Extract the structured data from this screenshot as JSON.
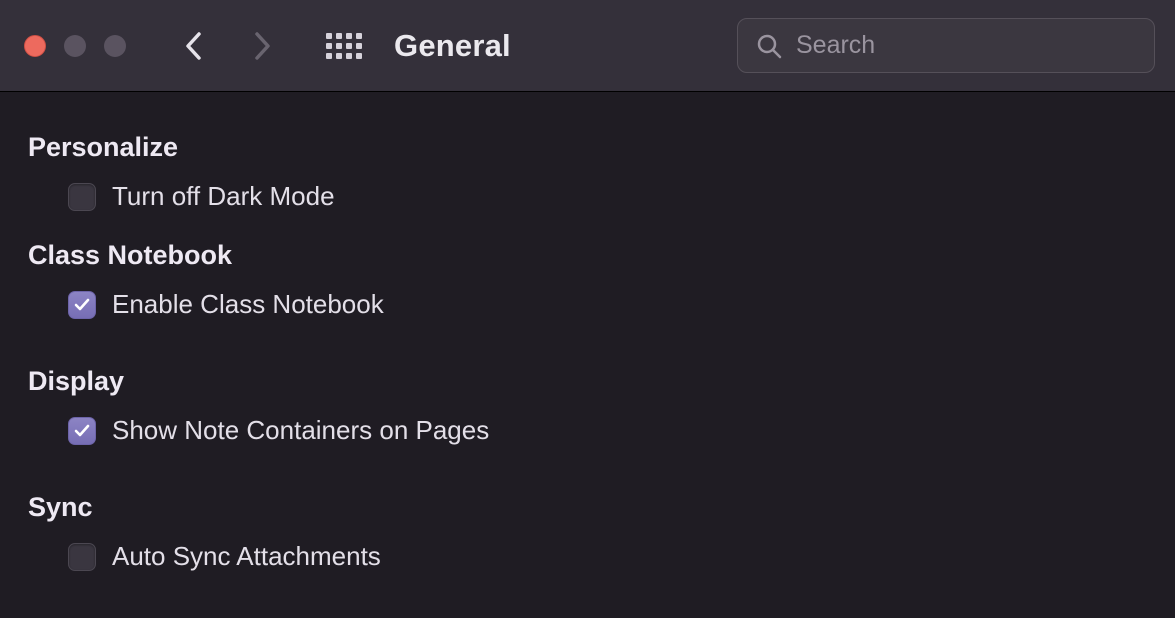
{
  "toolbar": {
    "title": "General",
    "search_placeholder": "Search"
  },
  "sections": {
    "personalize": {
      "header": "Personalize",
      "dark_mode_label": "Turn off Dark Mode",
      "dark_mode_checked": false
    },
    "class_notebook": {
      "header": "Class Notebook",
      "enable_label": "Enable Class Notebook",
      "enable_checked": true
    },
    "display": {
      "header": "Display",
      "show_containers_label": "Show Note Containers on Pages",
      "show_containers_checked": true
    },
    "sync": {
      "header": "Sync",
      "auto_sync_label": "Auto Sync Attachments",
      "auto_sync_checked": false
    }
  }
}
